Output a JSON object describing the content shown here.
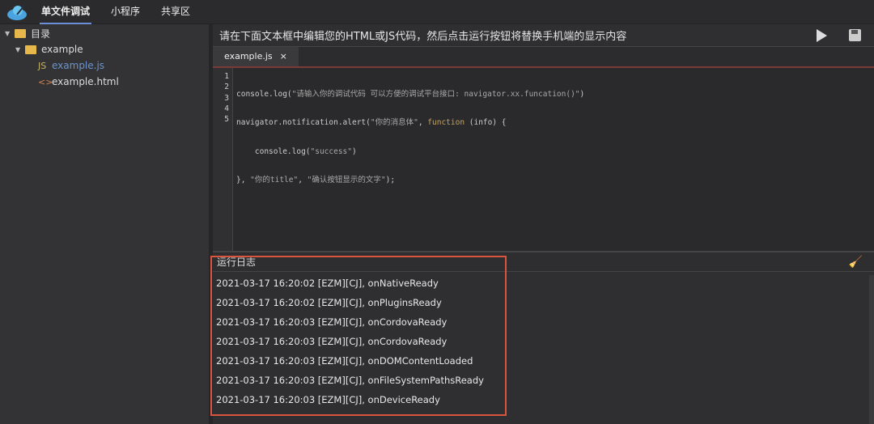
{
  "topnav": {
    "items": [
      "单文件调试",
      "小程序",
      "共享区"
    ]
  },
  "sidebar": {
    "root": "目录",
    "folder": "example",
    "files": [
      {
        "label": "example.js",
        "badge": "JS"
      },
      {
        "label": "example.html",
        "badge": "<>"
      }
    ]
  },
  "instruction": "请在下面文本框中编辑您的HTML或JS代码，然后点击运行按钮将替换手机端的显示内容",
  "tab": {
    "label": "example.js",
    "close": "×"
  },
  "editor": {
    "line_numbers": [
      "1",
      "2",
      "3",
      "4",
      "5"
    ]
  },
  "log": {
    "title": "运行日志",
    "lines": [
      "2021-03-17 16:20:02 [EZM][CJ], onNativeReady",
      "2021-03-17 16:20:02 [EZM][CJ], onPluginsReady",
      "2021-03-17 16:20:03 [EZM][CJ], onCordovaReady",
      "2021-03-17 16:20:03 [EZM][CJ], onCordovaReady",
      "2021-03-17 16:20:03 [EZM][CJ], onDOMContentLoaded",
      "2021-03-17 16:20:03 [EZM][CJ], onFileSystemPathsReady",
      "2021-03-17 16:20:03 [EZM][CJ], onDeviceReady"
    ]
  },
  "code": {
    "l1a": "console.log(",
    "l1b": "\"请输入你的调试代码 可以方便的调试平台接口: navigator.xx.funcation()\"",
    "l1c": ")",
    "l2a": "navigator.notification.alert(",
    "l2b": "\"你的消息体\"",
    "l2c": ", ",
    "l2d": "function",
    "l2e": " (info) {",
    "l3a": "    console.log(",
    "l3b": "\"success\"",
    "l3c": ")",
    "l4a": "}, ",
    "l4b": "\"你的title\"",
    "l4c": ", ",
    "l4d": "\"确认按钮显示的文字\"",
    "l4e": ");"
  }
}
